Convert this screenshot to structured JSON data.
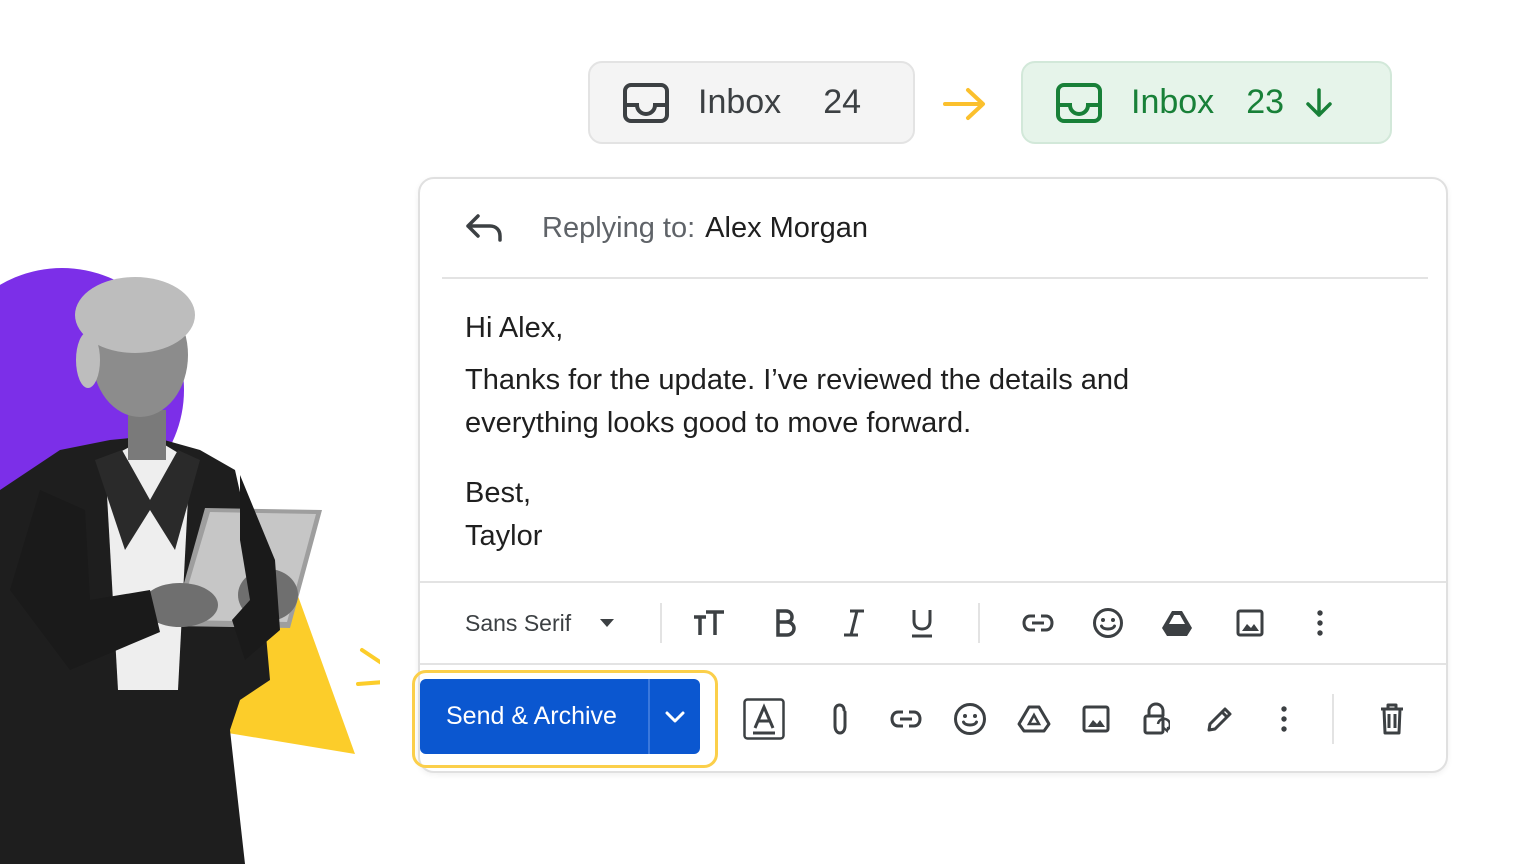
{
  "inbox_before": {
    "label": "Inbox",
    "count": "24"
  },
  "inbox_after": {
    "label": "Inbox",
    "count": "23"
  },
  "compose": {
    "reply_label": "Replying to:",
    "reply_name": "Alex Morgan",
    "body": {
      "greeting": "Hi Alex,",
      "line1": "Thanks for the update. I’ve reviewed the details and",
      "line2": "everything looks good to move forward.",
      "signoff": "Best,",
      "signature": "Taylor"
    },
    "formatting_toolbar": {
      "font": "Sans Serif",
      "icons": [
        "text-size-icon",
        "bold-icon",
        "italic-icon",
        "underline-icon",
        "link-icon",
        "emoji-icon",
        "drive-icon",
        "image-icon",
        "more-options-icon"
      ]
    },
    "action_toolbar": {
      "send_label": "Send & Archive",
      "icons": [
        "formatting-options-icon",
        "attach-icon",
        "link-icon",
        "emoji-icon",
        "drive-icon",
        "image-icon",
        "confidential-mode-icon",
        "signature-icon",
        "more-options-icon",
        "discard-icon"
      ]
    }
  },
  "colors": {
    "accent_blue": "#0b57d0",
    "highlight_yellow": "#fbcf4a",
    "inbox_green": "#188038",
    "inbox_green_bg": "#e6f4ea",
    "deco_purple": "#7c2fe8",
    "deco_yellow": "#fccd2a"
  }
}
